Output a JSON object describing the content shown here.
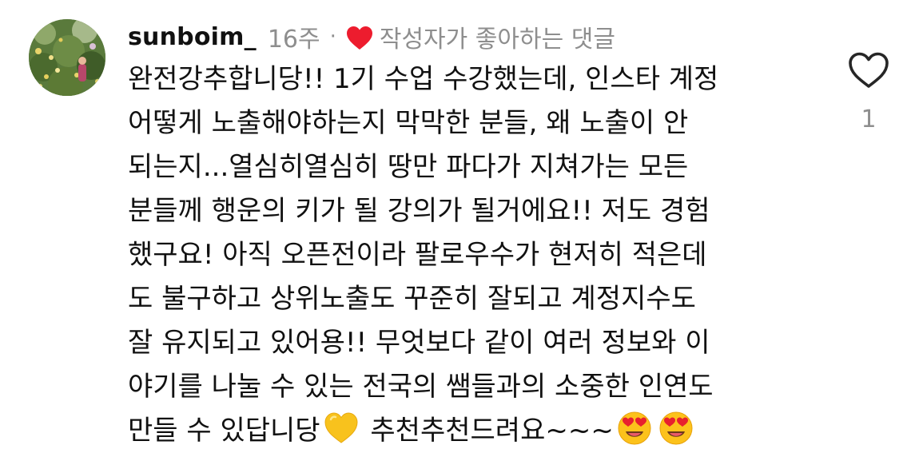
{
  "comment": {
    "username": "sunboim_",
    "age": "16주",
    "separator": "·",
    "author_liked_label": "작성자가 좋아하는 댓글",
    "text_lines": [
      "완전강추합니당!! 1기 수업 수강했는데, 인스타 계정",
      "어떻게 노출해야하는지 막막한 분들, 왜 노출이 안",
      "되는지...열심히열심히 땅만 파다가 지쳐가는 모든",
      "분들께 행운의 키가 될 강의가 될거에요!! 저도 경험",
      "했구요! 아직 오픈전이라 팔로우수가 현저히 적은데",
      "도 불구하고 상위노출도 꾸준히 잘되고 계정지수도",
      "잘 유지되고 있어용!! 무엇보다 같이 여러 정보와 이",
      "야기를 나눌 수 있는 전국의 쌤들과의 소중한 인연도"
    ],
    "last_line_part1": "만들 수 있답니당",
    "last_line_part2": "추천추천드려요~~~",
    "like_count": "1"
  },
  "icons": {
    "author_heart": "red-heart-icon",
    "yellow_heart": "yellow-heart-emoji",
    "heart_eyes": "heart-eyes-emoji",
    "like": "heart-outline-icon"
  },
  "colors": {
    "author_heart": "#ed1c2e",
    "meta_text": "#8e8e8e",
    "body_text": "#111111",
    "like_outline": "#262626"
  }
}
